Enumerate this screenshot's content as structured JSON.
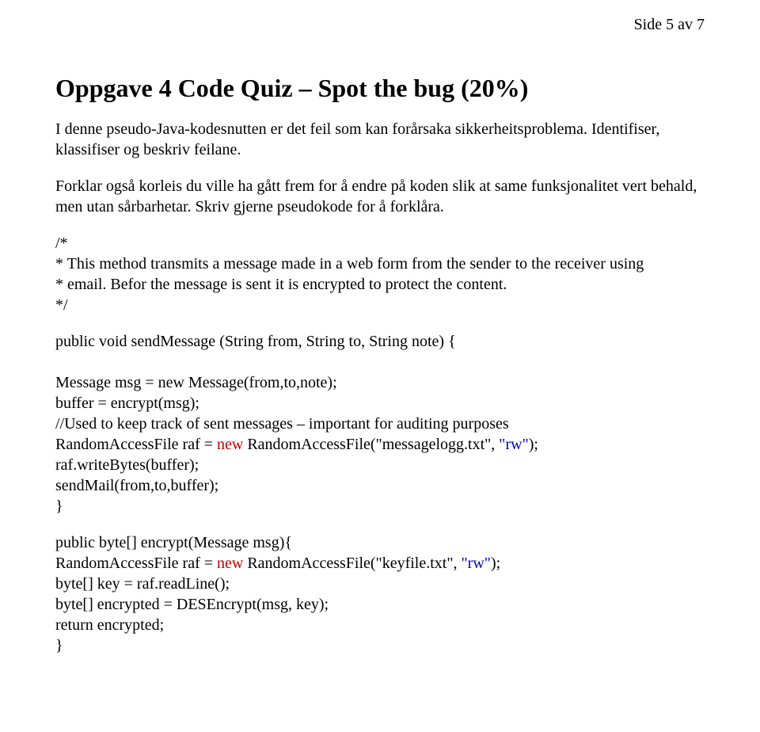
{
  "header": {
    "page_label": "Side 5 av 7"
  },
  "title": "Oppgave 4 Code Quiz – Spot the bug (20%)",
  "intro1": "I denne pseudo-Java-kodesnutten er det feil som kan forårsaka sikkerheitsproblema. Identifiser, klassifiser og beskriv feilane.",
  "intro2": "Forklar også korleis du ville ha gått frem for å endre på koden slik at same funksjonalitet vert behald, men utan sårbarhetar. Skriv gjerne pseudokode for å forklåra.",
  "comment_block": "/*\n* This method transmits a message made in a web form from the sender to the receiver using\n* email. Befor the message is sent it is encrypted to protect the content.\n*/",
  "code": {
    "l1": "public void sendMessage (String from, String to, String note) {",
    "l2": "Message msg = new Message(from,to,note);",
    "l3": "buffer = encrypt(msg);",
    "l4": "//Used to keep track of sent messages – important for auditing purposes",
    "l5a": "RandomAccessFile raf = ",
    "kw_new1": "new",
    "l5b": " RandomAccessFile(\"messagelogg.txt\", ",
    "str_rw1": "\"rw\"",
    "l5c": ");",
    "l6": "raf.writeBytes(buffer);",
    "l7": "sendMail(from,to,buffer);",
    "l8": "}",
    "l9": "public byte[] encrypt(Message msg){",
    "l10a": "RandomAccessFile raf = ",
    "kw_new2": "new",
    "l10b": " RandomAccessFile(\"keyfile.txt\", ",
    "str_rw2": "\"rw\"",
    "l10c": ");",
    "l11": "byte[] key = raf.readLine();",
    "l12": "byte[] encrypted = DESEncrypt(msg, key);",
    "l13": "return encrypted;",
    "l14": "}"
  }
}
